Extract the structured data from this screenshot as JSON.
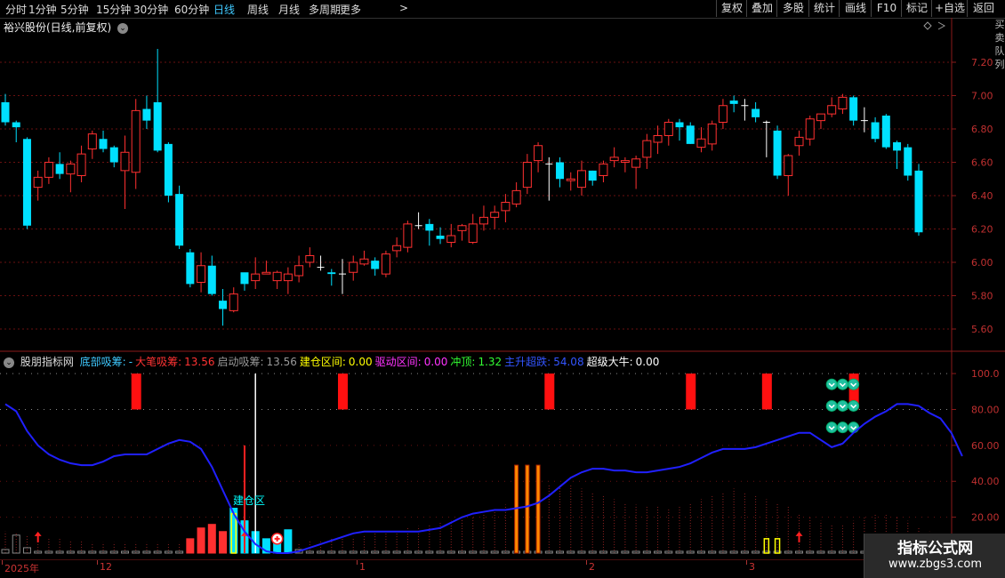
{
  "toolbar": {
    "periods": [
      "分时",
      "1分钟",
      "5分钟",
      "15分钟",
      "30分钟",
      "60分钟",
      "日线",
      "周线",
      "月线",
      "多周期",
      "更多"
    ],
    "more_arrow": ">",
    "active_period": "日线",
    "buttons": [
      "复权",
      "叠加",
      "多股",
      "统计",
      "画线",
      "F10",
      "标记",
      "+自选",
      "返回"
    ]
  },
  "stock": {
    "title": "裕兴股份(日线,前复权)",
    "yaxis_ticks": [
      "7.20",
      "7.00",
      "6.80",
      "6.60",
      "6.40",
      "6.20",
      "6.00",
      "5.80",
      "5.60"
    ],
    "right_strip_text": "买卖队列"
  },
  "indicator": {
    "name": "股朋指标网",
    "params": [
      {
        "label": "底部吸筹:",
        "value": "-",
        "color": "#3fc9ff"
      },
      {
        "label": "大笔吸筹:",
        "value": "13.56",
        "color": "#ff3333"
      },
      {
        "label": "启动吸筹:",
        "value": "13.56",
        "color": "#999999"
      },
      {
        "label": "建仓区间:",
        "value": "0.00",
        "color": "#ffff00"
      },
      {
        "label": "驱动区间:",
        "value": "0.00",
        "color": "#ff33ff"
      },
      {
        "label": "冲顶:",
        "value": "1.32",
        "color": "#33ff33"
      },
      {
        "label": "主升超跌:",
        "value": "54.08",
        "color": "#3355ff"
      },
      {
        "label": "超级大牛:",
        "value": "0.00",
        "color": "#ffffff"
      }
    ],
    "yaxis_ticks": [
      "100.0",
      "80.00",
      "60.00",
      "40.00",
      "20.00"
    ],
    "zone_label": "建仓区"
  },
  "xaxis": {
    "labels": [
      "2025年",
      "12",
      "1",
      "2",
      "3"
    ]
  },
  "watermark": {
    "title": "指标公式网",
    "url": "www.zbgs3.com"
  },
  "colors": {
    "up": "#ff3030",
    "down": "#00e0ff",
    "grid": "#6a1010",
    "axis": "#8b1a1a",
    "line": "#2020ff"
  },
  "chart_data": {
    "type": "candlestick",
    "ylim": [
      5.52,
      7.36
    ],
    "candles": [
      [
        6.96,
        6.84,
        7.01,
        6.82
      ],
      [
        6.84,
        6.81,
        6.85,
        6.72
      ],
      [
        6.74,
        6.22,
        6.75,
        6.2
      ],
      [
        6.45,
        6.51,
        6.55,
        6.37
      ],
      [
        6.51,
        6.6,
        6.63,
        6.47
      ],
      [
        6.59,
        6.53,
        6.66,
        6.5
      ],
      [
        6.53,
        6.59,
        6.61,
        6.42
      ],
      [
        6.52,
        6.65,
        6.7,
        6.48
      ],
      [
        6.68,
        6.77,
        6.79,
        6.62
      ],
      [
        6.74,
        6.68,
        6.79,
        6.66
      ],
      [
        6.69,
        6.6,
        6.7,
        6.57
      ],
      [
        6.55,
        6.66,
        6.76,
        6.32
      ],
      [
        6.54,
        6.91,
        6.98,
        6.44
      ],
      [
        6.92,
        6.85,
        7.0,
        6.8
      ],
      [
        6.96,
        6.67,
        7.28,
        6.66
      ],
      [
        6.71,
        6.4,
        6.72,
        6.36
      ],
      [
        6.41,
        6.1,
        6.46,
        6.08
      ],
      [
        6.06,
        5.87,
        6.08,
        5.85
      ],
      [
        5.88,
        5.98,
        6.06,
        5.82
      ],
      [
        5.98,
        5.81,
        6.04,
        5.8
      ],
      [
        5.77,
        5.72,
        5.84,
        5.62
      ],
      [
        5.71,
        5.81,
        5.85,
        5.7
      ],
      [
        5.94,
        5.87,
        5.92,
        5.83
      ],
      [
        5.89,
        5.93,
        6.03,
        5.84
      ],
      [
        5.93,
        5.94,
        6.01,
        5.93
      ],
      [
        5.89,
        5.94,
        5.95,
        5.84
      ],
      [
        5.89,
        5.93,
        5.97,
        5.81
      ],
      [
        5.92,
        5.98,
        6.04,
        5.88
      ],
      [
        6.0,
        6.04,
        6.09,
        5.97
      ],
      [
        5.97,
        5.97,
        6.04,
        5.95
      ],
      [
        5.94,
        5.93,
        5.96,
        5.86
      ],
      [
        5.93,
        5.93,
        6.02,
        5.81
      ],
      [
        5.94,
        6.0,
        6.04,
        5.89
      ],
      [
        5.99,
        6.02,
        6.07,
        5.98
      ],
      [
        6.01,
        5.96,
        6.03,
        5.92
      ],
      [
        5.93,
        6.05,
        6.07,
        5.91
      ],
      [
        6.07,
        6.1,
        6.15,
        6.03
      ],
      [
        6.09,
        6.23,
        6.25,
        6.06
      ],
      [
        6.22,
        6.22,
        6.3,
        6.2
      ],
      [
        6.23,
        6.19,
        6.26,
        6.1
      ],
      [
        6.16,
        6.14,
        6.21,
        6.11
      ],
      [
        6.12,
        6.16,
        6.23,
        6.09
      ],
      [
        6.19,
        6.22,
        6.23,
        6.13
      ],
      [
        6.12,
        6.23,
        6.29,
        6.11
      ],
      [
        6.23,
        6.27,
        6.34,
        6.19
      ],
      [
        6.27,
        6.3,
        6.34,
        6.2
      ],
      [
        6.31,
        6.36,
        6.41,
        6.24
      ],
      [
        6.35,
        6.43,
        6.48,
        6.33
      ],
      [
        6.45,
        6.6,
        6.65,
        6.41
      ],
      [
        6.61,
        6.7,
        6.72,
        6.54
      ],
      [
        6.59,
        6.59,
        6.63,
        6.37
      ],
      [
        6.6,
        6.5,
        6.63,
        6.45
      ],
      [
        6.49,
        6.5,
        6.54,
        6.43
      ],
      [
        6.45,
        6.55,
        6.61,
        6.4
      ],
      [
        6.55,
        6.49,
        6.55,
        6.46
      ],
      [
        6.52,
        6.59,
        6.61,
        6.48
      ],
      [
        6.61,
        6.63,
        6.69,
        6.57
      ],
      [
        6.6,
        6.61,
        6.63,
        6.54
      ],
      [
        6.57,
        6.62,
        6.64,
        6.44
      ],
      [
        6.63,
        6.73,
        6.77,
        6.56
      ],
      [
        6.72,
        6.76,
        6.82,
        6.65
      ],
      [
        6.76,
        6.84,
        6.86,
        6.7
      ],
      [
        6.84,
        6.81,
        6.86,
        6.73
      ],
      [
        6.82,
        6.71,
        6.84,
        6.71
      ],
      [
        6.69,
        6.74,
        6.81,
        6.66
      ],
      [
        6.71,
        6.83,
        6.85,
        6.67
      ],
      [
        6.84,
        6.94,
        6.98,
        6.8
      ],
      [
        6.97,
        6.95,
        7.0,
        6.9
      ],
      [
        6.94,
        6.94,
        6.98,
        6.85
      ],
      [
        6.92,
        6.87,
        6.96,
        6.84
      ],
      [
        6.84,
        6.84,
        6.85,
        6.63
      ],
      [
        6.79,
        6.52,
        6.82,
        6.5
      ],
      [
        6.52,
        6.64,
        6.65,
        6.4
      ],
      [
        6.7,
        6.75,
        6.79,
        6.64
      ],
      [
        6.74,
        6.86,
        6.88,
        6.7
      ],
      [
        6.85,
        6.89,
        6.89,
        6.8
      ],
      [
        6.89,
        6.94,
        6.99,
        6.87
      ],
      [
        6.92,
        6.99,
        7.01,
        6.89
      ],
      [
        6.99,
        6.85,
        7.0,
        6.82
      ],
      [
        6.85,
        6.85,
        6.93,
        6.78
      ],
      [
        6.84,
        6.74,
        6.87,
        6.72
      ],
      [
        6.88,
        6.69,
        6.89,
        6.68
      ],
      [
        6.72,
        6.67,
        6.73,
        6.56
      ],
      [
        6.69,
        6.52,
        6.71,
        6.49
      ],
      [
        6.55,
        6.18,
        6.59,
        6.16
      ]
    ],
    "line_series": {
      "name": "主升超跌",
      "values": [
        83,
        79,
        68,
        60,
        55,
        52,
        50,
        49,
        49,
        51,
        54,
        55,
        55,
        55,
        58,
        61,
        63,
        62,
        58,
        48,
        35,
        22,
        12,
        5,
        1,
        0,
        0,
        1,
        3,
        5,
        7,
        9,
        11,
        12,
        12,
        12,
        12,
        12,
        12,
        13,
        14,
        17,
        20,
        22,
        23,
        24,
        24,
        25,
        26,
        28,
        32,
        37,
        42,
        45,
        47,
        47,
        46,
        46,
        45,
        45,
        46,
        47,
        48,
        50,
        53,
        56,
        58,
        58,
        58,
        59,
        61,
        63,
        65,
        67,
        67,
        63,
        59,
        61,
        67,
        72,
        76,
        79,
        83,
        83,
        82,
        78,
        75,
        67,
        54
      ]
    },
    "bars": [
      2,
      10,
      3,
      1,
      1,
      1,
      1,
      1,
      1,
      1,
      1,
      1,
      1,
      1,
      1,
      1,
      1,
      8,
      14,
      16,
      12,
      25,
      18,
      12,
      8,
      8,
      13,
      2,
      1,
      1,
      1,
      1,
      1,
      1,
      1,
      1,
      1,
      1,
      1,
      1,
      1,
      1,
      1,
      1,
      1,
      1,
      1,
      1,
      1,
      1,
      1,
      1,
      1,
      1,
      1,
      1,
      1,
      1,
      1,
      1,
      1,
      1,
      1,
      1,
      1,
      1,
      1,
      1,
      1,
      1,
      1,
      1,
      1,
      1,
      1,
      1,
      1,
      1,
      1,
      1,
      1,
      1,
      1,
      1,
      1,
      1,
      1,
      1,
      3
    ],
    "background_bars": [
      12,
      11,
      10,
      9,
      8,
      8,
      7,
      7,
      6,
      6,
      6,
      6,
      6,
      6,
      6,
      6,
      6,
      6,
      6,
      6,
      6,
      6,
      6,
      6,
      6,
      6,
      6,
      6,
      7,
      7,
      8,
      8,
      9,
      10,
      11,
      12,
      13,
      14,
      15,
      16,
      17,
      18,
      19,
      20,
      22,
      24,
      27,
      30,
      34,
      36,
      38,
      38,
      38,
      36,
      34,
      32,
      30,
      28,
      27,
      26,
      26,
      25,
      26,
      28,
      30,
      32,
      34,
      36,
      34,
      32,
      30,
      28,
      26,
      22,
      20,
      18,
      16,
      16,
      18,
      20,
      22,
      22,
      20,
      18,
      14,
      12,
      10,
      8,
      6
    ],
    "signal_blocks": [
      {
        "label": "大笔吸筹",
        "top": 100,
        "bottom": 80
      },
      {
        "label": "大笔吸筹",
        "top": 100,
        "bottom": 80
      },
      {
        "label": "大笔吸筹",
        "top": 100,
        "bottom": 80
      },
      {
        "label": "大笔吸筹",
        "top": 100,
        "bottom": 80
      },
      {
        "label": "大笔吸筹",
        "top": 100,
        "bottom": 80
      },
      {
        "label": "大笔吸筹",
        "top": 100,
        "bottom": 80
      }
    ],
    "ylim_indicator": [
      0,
      105
    ]
  }
}
